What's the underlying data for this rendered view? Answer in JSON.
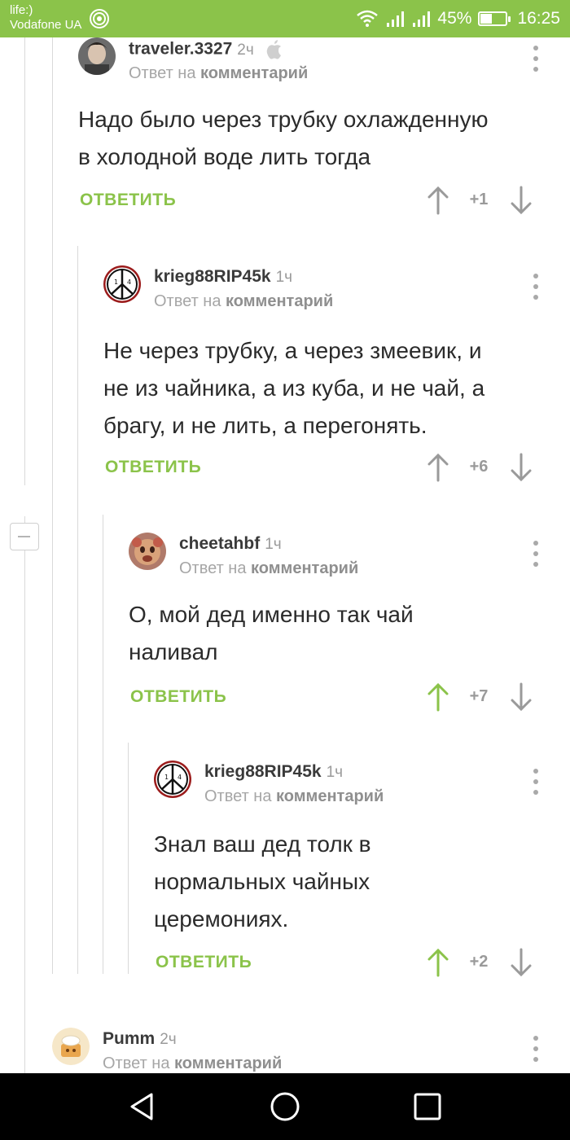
{
  "status_bar": {
    "carrier_line1": "life:)",
    "carrier_line2": "Vodafone UA",
    "battery_text": "45%",
    "battery_level": 0.45,
    "time": "16:25",
    "icons": [
      "hotspot-icon",
      "wifi-icon",
      "signal-icon",
      "signal-icon",
      "battery-icon"
    ]
  },
  "comments": [
    {
      "username": "traveler.3327",
      "time": "2ч",
      "platform_icon": "apple-icon",
      "reply_prefix": "Ответ на",
      "reply_target": "комментарий",
      "text_lines": [
        "Надо было через трубку охлажденную",
        "в холодной воде лить тогда"
      ],
      "reply_label": "ОТВЕТИТЬ",
      "score": "+1",
      "upvoted": false
    },
    {
      "username": "krieg88RIP45k",
      "time": "1ч",
      "reply_prefix": "Ответ на",
      "reply_target": "комментарий",
      "text_lines": [
        "Не через трубку, а через змеевик, и",
        "не из чайника, а из куба, и не чай, а",
        "брагу, и не лить, а перегонять."
      ],
      "reply_label": "ОТВЕТИТЬ",
      "score": "+6",
      "upvoted": false
    },
    {
      "username": "cheetahbf",
      "time": "1ч",
      "reply_prefix": "Ответ на",
      "reply_target": "комментарий",
      "text_lines": [
        "О, мой дед именно так чай",
        "наливал"
      ],
      "reply_label": "ОТВЕТИТЬ",
      "score": "+7",
      "upvoted": true
    },
    {
      "username": "krieg88RIP45k",
      "time": "1ч",
      "reply_prefix": "Ответ на",
      "reply_target": "комментарий",
      "text_lines": [
        "Знал ваш дед толк в",
        "нормальных чайных",
        "церемониях."
      ],
      "reply_label": "ОТВЕТИТЬ",
      "score": "+2",
      "upvoted": true
    },
    {
      "username": "Pumm",
      "time": "2ч",
      "reply_prefix": "Ответ на",
      "reply_target": "комментарий"
    }
  ],
  "colors": {
    "accent": "#8bc34a",
    "status_bar": "#8bc34a",
    "text": "#2b2b2b",
    "muted": "#a6a6a6",
    "nav_bar": "#000000"
  },
  "nav_bar": {
    "icons": [
      "back-icon",
      "home-icon",
      "recents-icon"
    ]
  }
}
